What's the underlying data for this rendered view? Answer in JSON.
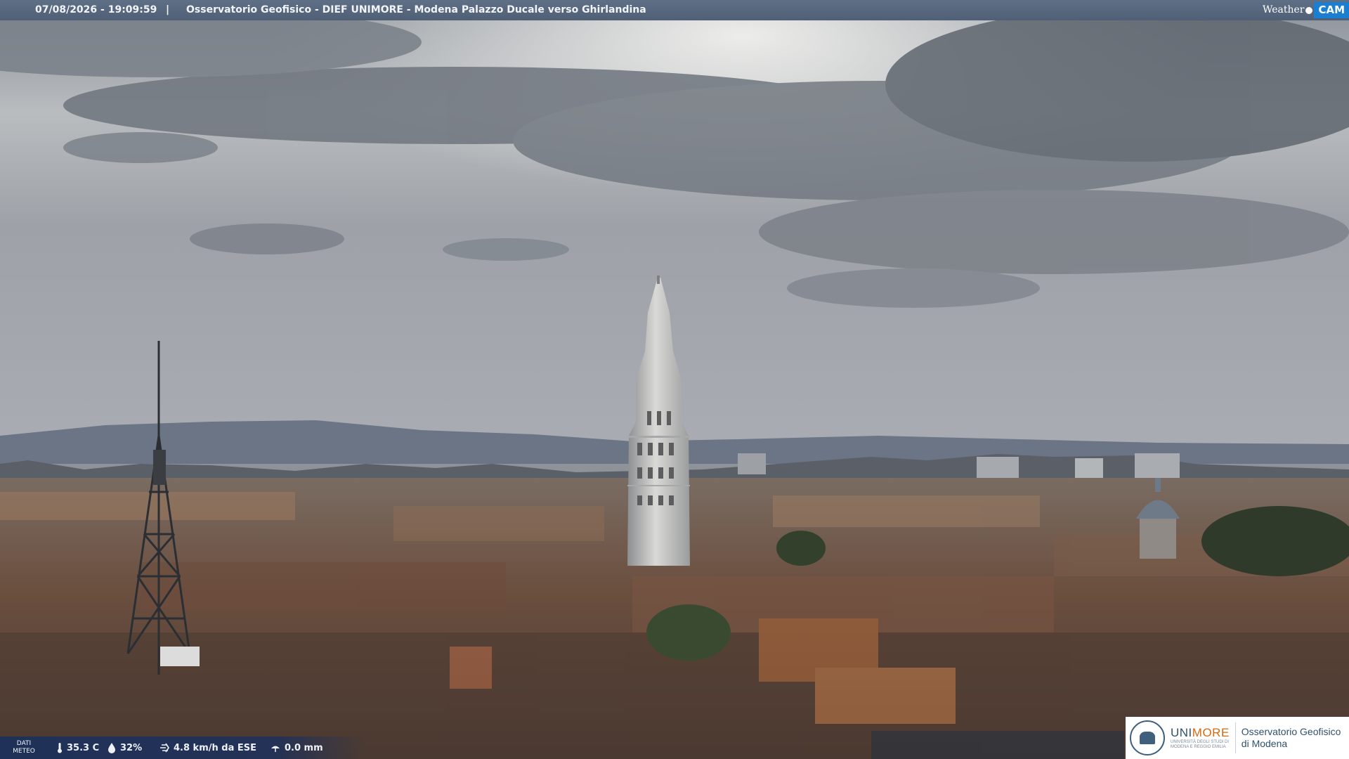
{
  "header": {
    "datetime": "07/08/2026 - 19:09:59",
    "separator": "|",
    "location": "Osservatorio Geofisico - DIEF UNIMORE - Modena Palazzo Ducale verso Ghirlandina",
    "logo_weather": "Weather",
    "logo_cam": "CAM"
  },
  "weather": {
    "label_line1": "DATI",
    "label_line2": "METEO",
    "temperature": "35.3 C",
    "humidity": "32%",
    "wind": "4.8 km/h da ESE",
    "rain": "0.0 mm",
    "icons": [
      "thermometer-icon",
      "humidity-drop-icon",
      "wind-icon",
      "rain-icon"
    ]
  },
  "branding": {
    "uni_name_prefix": "UNI",
    "uni_name_suffix": "MORE",
    "uni_subtitle_line1": "UNIVERSITÀ DEGLI STUDI DI",
    "uni_subtitle_line2": "MODENA E REGGIO EMILIA",
    "observatory_line1": "Osservatorio Geofisico",
    "observatory_line2": "di Modena"
  },
  "colors": {
    "header_bar": "#546480",
    "cam_logo": "#1a7fd1",
    "unimore_blue": "#2f5170",
    "unimore_orange": "#d46a12"
  }
}
